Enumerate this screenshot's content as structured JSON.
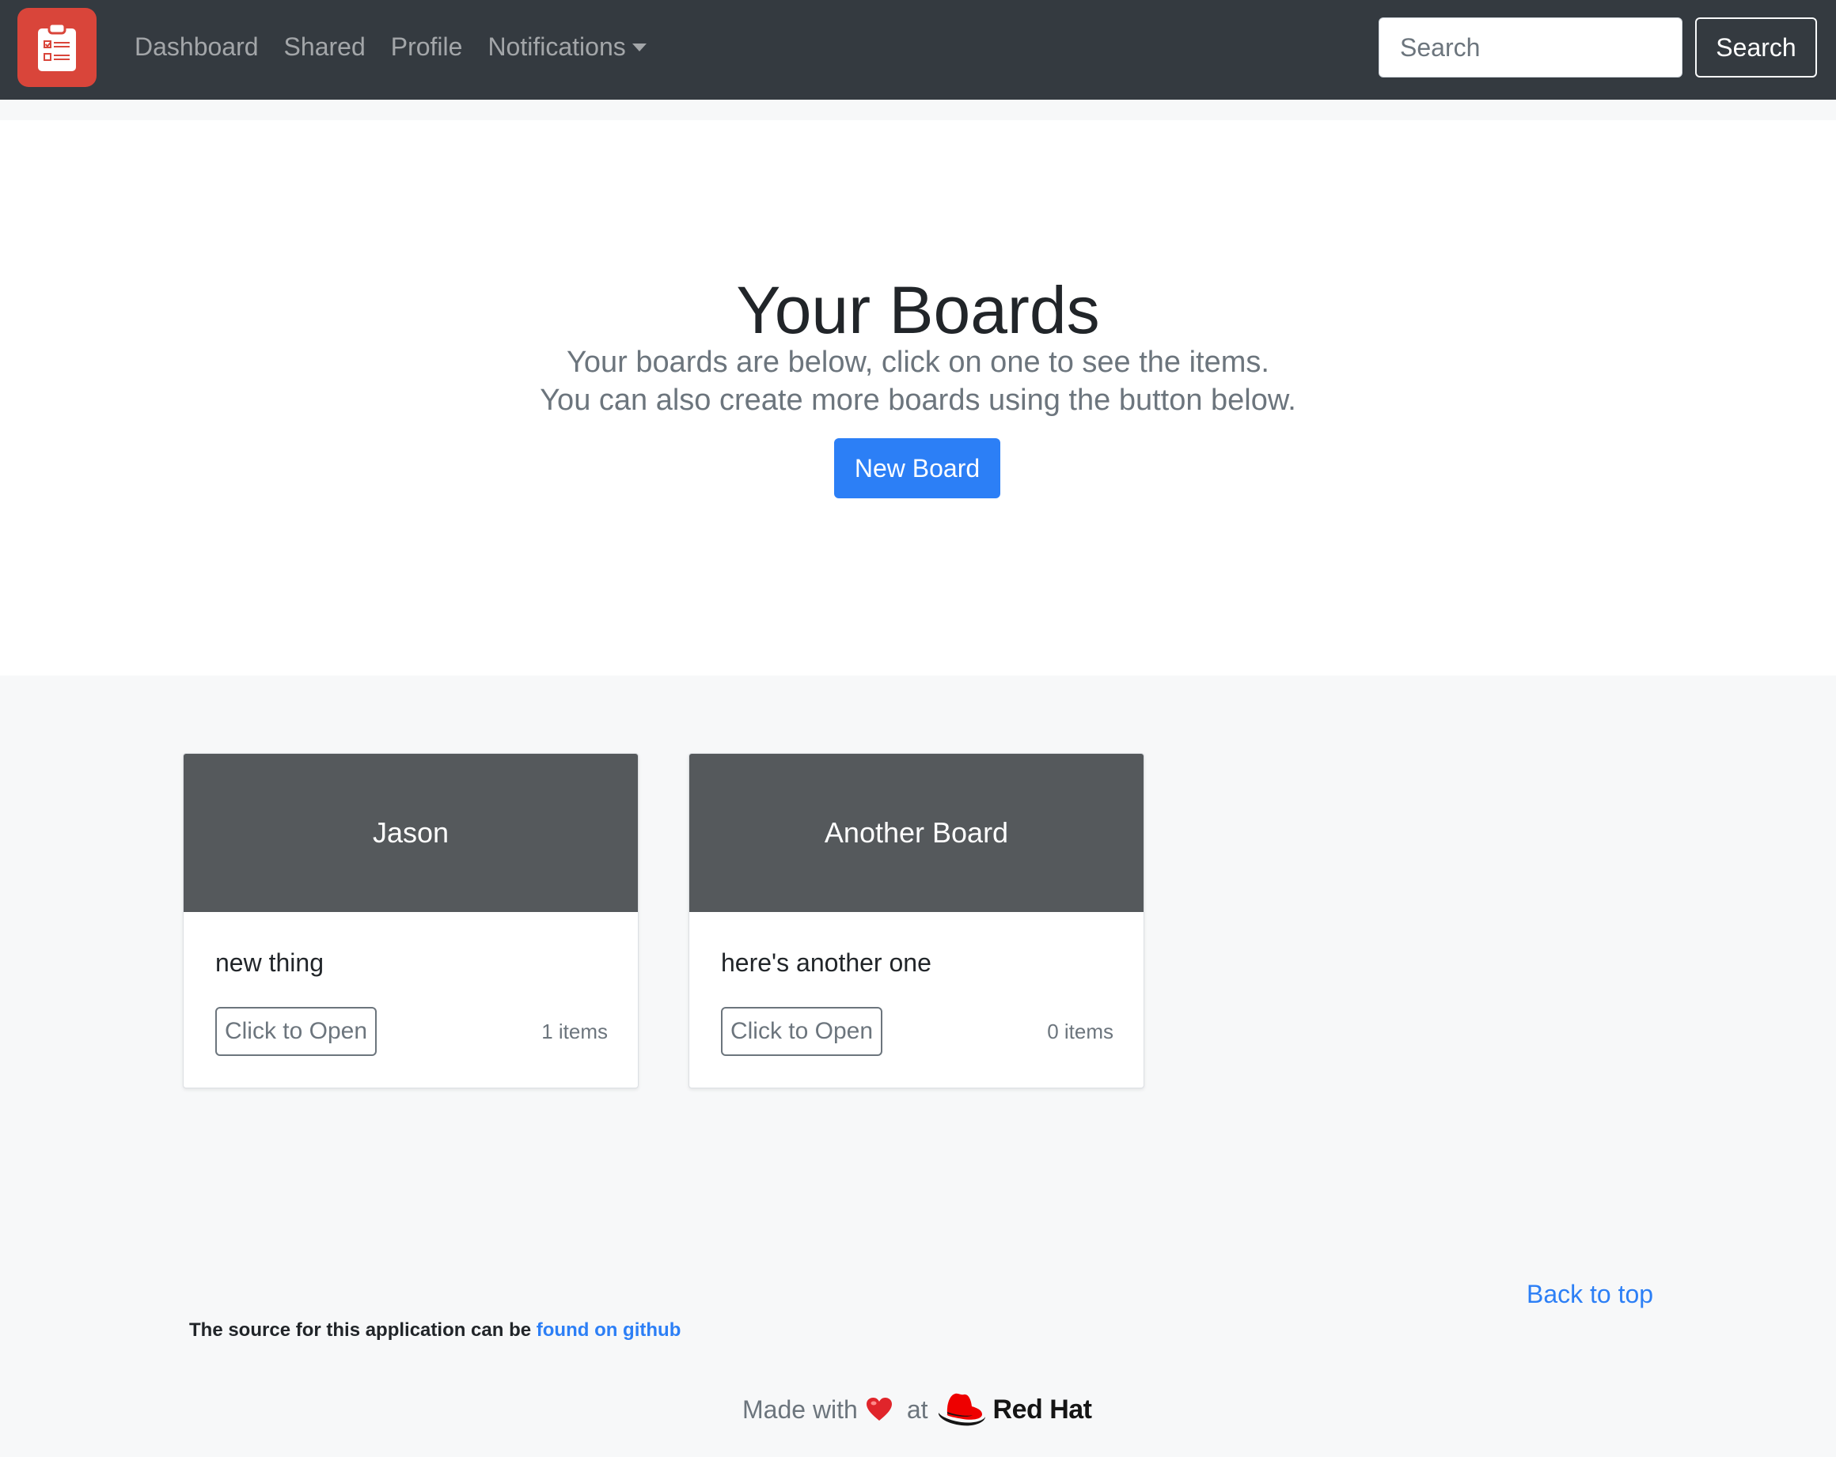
{
  "navbar": {
    "links": [
      "Dashboard",
      "Shared",
      "Profile",
      "Notifications"
    ],
    "search_placeholder": "Search",
    "search_button": "Search"
  },
  "hero": {
    "title": "Your Boards",
    "lead_line1": "Your boards are below, click on one to see the items.",
    "lead_line2": "You can also create more boards using the button below.",
    "new_board_button": "New Board"
  },
  "boards": [
    {
      "name": "Jason",
      "description": "new thing",
      "open_label": "Click to Open",
      "count": "1 items"
    },
    {
      "name": "Another Board",
      "description": "here's another one",
      "open_label": "Click to Open",
      "count": "0 items"
    }
  ],
  "footer": {
    "back_to_top": "Back to top",
    "source_text": "The source for this application can be",
    "source_link": "found on github",
    "made_with": "Made with",
    "at": "at",
    "brand": "Red Hat"
  },
  "colors": {
    "navbar_bg": "#343a40",
    "logo_bg": "#d9453a",
    "primary": "#2c7ff6",
    "card_header_bg": "#55595c"
  },
  "icons": [
    "clipboard-checklist-icon",
    "caret-down-icon",
    "heart-icon",
    "red-hat-logo"
  ]
}
